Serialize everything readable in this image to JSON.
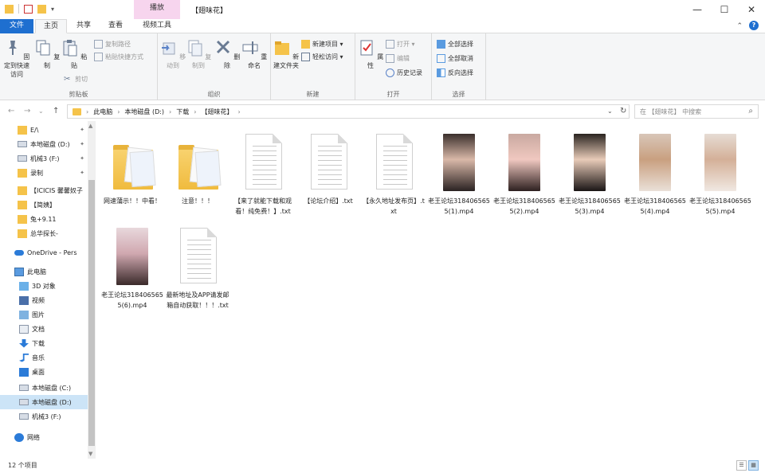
{
  "window": {
    "context_tab": "播放",
    "title": "【翅味花】",
    "minimize": "—",
    "maximize": "☐",
    "close": "✕"
  },
  "tabs": [
    {
      "label": "文件"
    },
    {
      "label": "主页"
    },
    {
      "label": "共享"
    },
    {
      "label": "查看"
    },
    {
      "label": "视频工具"
    }
  ],
  "ribbon": {
    "clipboard": {
      "pin": "固定到快速访问",
      "copy": "复制",
      "paste": "粘贴",
      "copy_path": "复制路径",
      "paste_shortcut": "粘贴快捷方式",
      "cut": "剪切",
      "label": "剪贴板"
    },
    "organize": {
      "move_to": "移动到",
      "copy_to": "复制到",
      "delete": "删除",
      "rename": "重命名",
      "label": "组织"
    },
    "new": {
      "new_folder": "新建文件夹",
      "new_item": "新建项目 ▾",
      "easy_access": "轻松访问 ▾",
      "label": "新建"
    },
    "open": {
      "properties": "属性",
      "open": "打开 ▾",
      "edit": "编辑",
      "history": "历史记录",
      "label": "打开"
    },
    "select": {
      "select_all": "全部选择",
      "select_none": "全部取消",
      "invert": "反向选择",
      "label": "选择"
    }
  },
  "address": {
    "back": "←",
    "forward": "→",
    "recent": "⌄",
    "up": "↑",
    "crumbs": [
      "此电脑",
      "本地磁盘 (D:)",
      "下载",
      "【翅味花】"
    ],
    "search_placeholder": "在 【翅味花】 中搜索"
  },
  "sidebar": [
    {
      "label": "E/\\",
      "icon": "folder-icon",
      "pinned": true
    },
    {
      "label": "本地磁盘 (D:)",
      "icon": "drive-icon",
      "pinned": true
    },
    {
      "label": "机械3 (F:)",
      "icon": "drive-icon",
      "pinned": true
    },
    {
      "label": "录制",
      "icon": "folder-icon",
      "pinned": true
    },
    {
      "label": "【ICICIS 馨馨奴子",
      "icon": "folder-icon",
      "pinned": false
    },
    {
      "label": "【简姨】",
      "icon": "folder-icon",
      "pinned": false
    },
    {
      "label": "兔+9.11",
      "icon": "folder-icon",
      "pinned": false
    },
    {
      "label": "总华探长-",
      "icon": "folder-icon",
      "pinned": false
    },
    {
      "label": "OneDrive - Pers",
      "icon": "cloud-icon",
      "pinned": false
    },
    {
      "label": "此电脑",
      "icon": "pc-icon",
      "pinned": false
    },
    {
      "label": "3D 对象",
      "icon": "cube-icon",
      "pinned": false
    },
    {
      "label": "视频",
      "icon": "video-icon",
      "pinned": false
    },
    {
      "label": "图片",
      "icon": "pictures-icon",
      "pinned": false
    },
    {
      "label": "文档",
      "icon": "documents-icon",
      "pinned": false
    },
    {
      "label": "下载",
      "icon": "download-icon",
      "pinned": false
    },
    {
      "label": "音乐",
      "icon": "music-icon",
      "pinned": false
    },
    {
      "label": "桌面",
      "icon": "desktop-icon",
      "pinned": false
    },
    {
      "label": "本地磁盘 (C:)",
      "icon": "drive-icon",
      "pinned": false
    },
    {
      "label": "本地磁盘 (D:)",
      "icon": "drive-icon",
      "pinned": false,
      "selected": true
    },
    {
      "label": "机械3 (F:)",
      "icon": "drive-icon",
      "pinned": false
    },
    {
      "label": "网络",
      "icon": "network-icon",
      "pinned": false
    }
  ],
  "files": [
    {
      "name": "网速蒲示！！中看！",
      "type": "folder"
    },
    {
      "name": "注意！！！",
      "type": "folder"
    },
    {
      "name": "【来了就能下载和观看！纯免费！】.txt",
      "type": "txt"
    },
    {
      "name": "【论坛介绍】.txt",
      "type": "txt"
    },
    {
      "name": "【永久地址发布页】.txt",
      "type": "txt"
    },
    {
      "name": "老王论坛3184065655(1).mp4",
      "type": "video"
    },
    {
      "name": "老王论坛3184065655(2).mp4",
      "type": "video"
    },
    {
      "name": "老王论坛3184065655(3).mp4",
      "type": "video"
    },
    {
      "name": "老王论坛3184065655(4).mp4",
      "type": "video"
    },
    {
      "name": "老王论坛3184065655(5).mp4",
      "type": "video"
    },
    {
      "name": "老王论坛3184065655(6).mp4",
      "type": "video"
    },
    {
      "name": "最新地址及APP请发邮箱自动获取！！！.txt",
      "type": "txt"
    }
  ],
  "status": {
    "count": "12 个项目"
  },
  "colors": {
    "accent": "#1e6fd0",
    "context_tab": "#f7d5ee",
    "selection": "#cce4f7",
    "folder": "#f5c34a"
  }
}
